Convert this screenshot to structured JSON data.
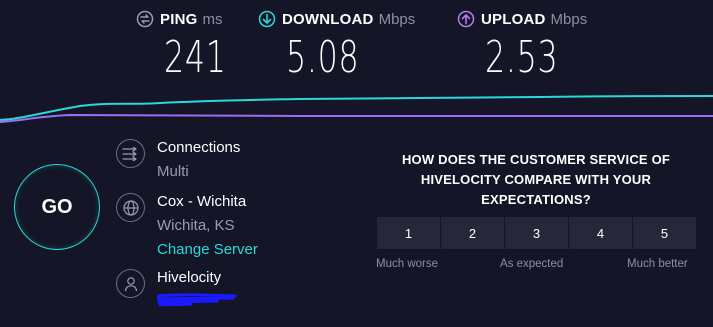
{
  "metrics": {
    "ping": {
      "label": "PING",
      "unit": "ms",
      "value": "241",
      "icon": "ping-icon",
      "color": "#9a9cb0"
    },
    "download": {
      "label": "DOWNLOAD",
      "unit": "Mbps",
      "value": "5.08",
      "icon": "download-icon",
      "color": "#2bd8d8"
    },
    "upload": {
      "label": "UPLOAD",
      "unit": "Mbps",
      "value": "2.53",
      "icon": "upload-icon",
      "color": "#b57cf0"
    }
  },
  "go_button": {
    "label": "GO"
  },
  "connections": {
    "title": "Connections",
    "value": "Multi",
    "icon": "connections-icon"
  },
  "server": {
    "title": "Cox - Wichita",
    "location": "Wichita, KS",
    "change_link": "Change Server",
    "icon": "globe-icon"
  },
  "isp": {
    "title": "Hivelocity",
    "icon": "user-icon"
  },
  "survey": {
    "question": "HOW DOES THE CUSTOMER SERVICE OF HIVELOCITY COMPARE WITH YOUR EXPECTATIONS?",
    "ratings": [
      "1",
      "2",
      "3",
      "4",
      "5"
    ],
    "scale_low": "Much worse",
    "scale_mid": "As expected",
    "scale_high": "Much better"
  },
  "colors": {
    "background": "#141526",
    "accent_download": "#2bd8d8",
    "accent_upload": "#b57cf0",
    "redaction": "#1a1aff"
  }
}
